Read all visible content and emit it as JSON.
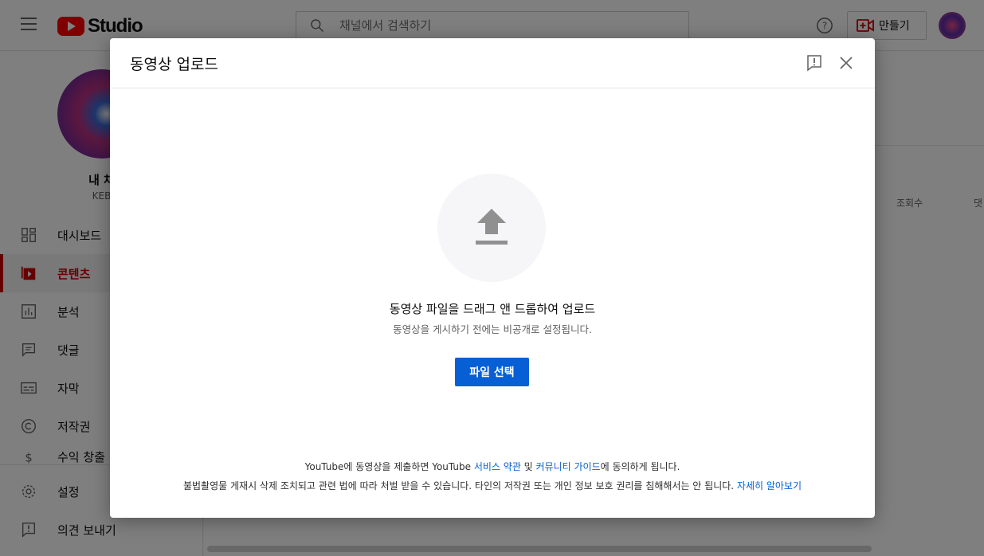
{
  "header": {
    "logo_text": "Studio",
    "search_placeholder": "채널에서 검색하기",
    "create_label": "만들기"
  },
  "sidebar": {
    "channel_title": "내 채",
    "channel_sub": "KEB",
    "items": [
      {
        "label": "대시보드",
        "icon": "dashboard-icon"
      },
      {
        "label": "콘텐츠",
        "icon": "content-icon",
        "active": true
      },
      {
        "label": "분석",
        "icon": "analytics-icon"
      },
      {
        "label": "댓글",
        "icon": "comments-icon"
      },
      {
        "label": "자막",
        "icon": "subtitles-icon"
      },
      {
        "label": "저작권",
        "icon": "copyright-icon"
      },
      {
        "label": "수익 창출",
        "icon": "monetization-icon"
      },
      {
        "label": "설정",
        "icon": "settings-icon"
      },
      {
        "label": "의견 보내기",
        "icon": "feedback-icon"
      }
    ]
  },
  "main": {
    "col_views": "조회수",
    "col_comments": "댓"
  },
  "dialog": {
    "title": "동영상 업로드",
    "drag_text": "동영상 파일을 드래그 앤 드롭하여 업로드",
    "drag_sub": "동영상을 게시하기 전에는 비공개로 설정됩니다.",
    "select_button": "파일 선택",
    "footer_1": {
      "a": "YouTube에 동영상을 제출하면 YouTube ",
      "terms_link": "서비스 약관",
      "b": " 및 ",
      "guidelines_link": "커뮤니티 가이드",
      "c": "에 동의하게 됩니다."
    },
    "footer_2": {
      "a": "불법촬영물 게재시 삭제 조치되고 관련 법에 따라 처벌 받을 수 있습니다. 타인의 저작권 또는 개인 정보 보호 권리를 침해해서는 안 됩니다. ",
      "learn_more_link": "자세히 알아보기"
    }
  },
  "colors": {
    "brand_red": "#ff0000",
    "active_red": "#cc0000",
    "primary_blue": "#065fd4"
  }
}
